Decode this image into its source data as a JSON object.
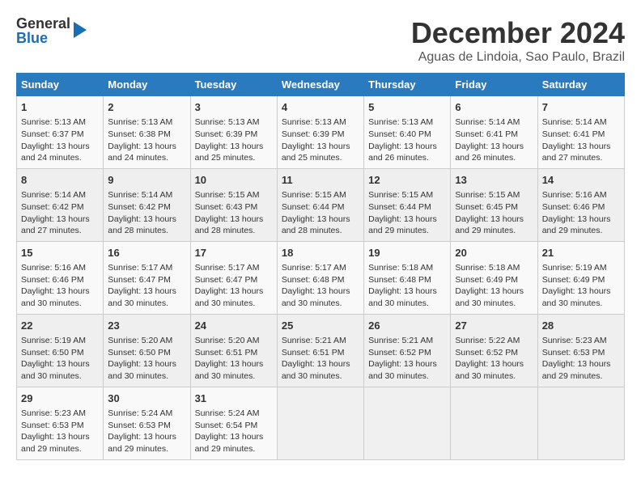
{
  "header": {
    "logo_general": "General",
    "logo_blue": "Blue",
    "month_title": "December 2024",
    "location": "Aguas de Lindoia, Sao Paulo, Brazil"
  },
  "weekdays": [
    "Sunday",
    "Monday",
    "Tuesday",
    "Wednesday",
    "Thursday",
    "Friday",
    "Saturday"
  ],
  "weeks": [
    [
      {
        "day": "1",
        "sunrise": "Sunrise: 5:13 AM",
        "sunset": "Sunset: 6:37 PM",
        "daylight": "Daylight: 13 hours and 24 minutes."
      },
      {
        "day": "2",
        "sunrise": "Sunrise: 5:13 AM",
        "sunset": "Sunset: 6:38 PM",
        "daylight": "Daylight: 13 hours and 24 minutes."
      },
      {
        "day": "3",
        "sunrise": "Sunrise: 5:13 AM",
        "sunset": "Sunset: 6:39 PM",
        "daylight": "Daylight: 13 hours and 25 minutes."
      },
      {
        "day": "4",
        "sunrise": "Sunrise: 5:13 AM",
        "sunset": "Sunset: 6:39 PM",
        "daylight": "Daylight: 13 hours and 25 minutes."
      },
      {
        "day": "5",
        "sunrise": "Sunrise: 5:13 AM",
        "sunset": "Sunset: 6:40 PM",
        "daylight": "Daylight: 13 hours and 26 minutes."
      },
      {
        "day": "6",
        "sunrise": "Sunrise: 5:14 AM",
        "sunset": "Sunset: 6:41 PM",
        "daylight": "Daylight: 13 hours and 26 minutes."
      },
      {
        "day": "7",
        "sunrise": "Sunrise: 5:14 AM",
        "sunset": "Sunset: 6:41 PM",
        "daylight": "Daylight: 13 hours and 27 minutes."
      }
    ],
    [
      {
        "day": "8",
        "sunrise": "Sunrise: 5:14 AM",
        "sunset": "Sunset: 6:42 PM",
        "daylight": "Daylight: 13 hours and 27 minutes."
      },
      {
        "day": "9",
        "sunrise": "Sunrise: 5:14 AM",
        "sunset": "Sunset: 6:42 PM",
        "daylight": "Daylight: 13 hours and 28 minutes."
      },
      {
        "day": "10",
        "sunrise": "Sunrise: 5:15 AM",
        "sunset": "Sunset: 6:43 PM",
        "daylight": "Daylight: 13 hours and 28 minutes."
      },
      {
        "day": "11",
        "sunrise": "Sunrise: 5:15 AM",
        "sunset": "Sunset: 6:44 PM",
        "daylight": "Daylight: 13 hours and 28 minutes."
      },
      {
        "day": "12",
        "sunrise": "Sunrise: 5:15 AM",
        "sunset": "Sunset: 6:44 PM",
        "daylight": "Daylight: 13 hours and 29 minutes."
      },
      {
        "day": "13",
        "sunrise": "Sunrise: 5:15 AM",
        "sunset": "Sunset: 6:45 PM",
        "daylight": "Daylight: 13 hours and 29 minutes."
      },
      {
        "day": "14",
        "sunrise": "Sunrise: 5:16 AM",
        "sunset": "Sunset: 6:46 PM",
        "daylight": "Daylight: 13 hours and 29 minutes."
      }
    ],
    [
      {
        "day": "15",
        "sunrise": "Sunrise: 5:16 AM",
        "sunset": "Sunset: 6:46 PM",
        "daylight": "Daylight: 13 hours and 30 minutes."
      },
      {
        "day": "16",
        "sunrise": "Sunrise: 5:17 AM",
        "sunset": "Sunset: 6:47 PM",
        "daylight": "Daylight: 13 hours and 30 minutes."
      },
      {
        "day": "17",
        "sunrise": "Sunrise: 5:17 AM",
        "sunset": "Sunset: 6:47 PM",
        "daylight": "Daylight: 13 hours and 30 minutes."
      },
      {
        "day": "18",
        "sunrise": "Sunrise: 5:17 AM",
        "sunset": "Sunset: 6:48 PM",
        "daylight": "Daylight: 13 hours and 30 minutes."
      },
      {
        "day": "19",
        "sunrise": "Sunrise: 5:18 AM",
        "sunset": "Sunset: 6:48 PM",
        "daylight": "Daylight: 13 hours and 30 minutes."
      },
      {
        "day": "20",
        "sunrise": "Sunrise: 5:18 AM",
        "sunset": "Sunset: 6:49 PM",
        "daylight": "Daylight: 13 hours and 30 minutes."
      },
      {
        "day": "21",
        "sunrise": "Sunrise: 5:19 AM",
        "sunset": "Sunset: 6:49 PM",
        "daylight": "Daylight: 13 hours and 30 minutes."
      }
    ],
    [
      {
        "day": "22",
        "sunrise": "Sunrise: 5:19 AM",
        "sunset": "Sunset: 6:50 PM",
        "daylight": "Daylight: 13 hours and 30 minutes."
      },
      {
        "day": "23",
        "sunrise": "Sunrise: 5:20 AM",
        "sunset": "Sunset: 6:50 PM",
        "daylight": "Daylight: 13 hours and 30 minutes."
      },
      {
        "day": "24",
        "sunrise": "Sunrise: 5:20 AM",
        "sunset": "Sunset: 6:51 PM",
        "daylight": "Daylight: 13 hours and 30 minutes."
      },
      {
        "day": "25",
        "sunrise": "Sunrise: 5:21 AM",
        "sunset": "Sunset: 6:51 PM",
        "daylight": "Daylight: 13 hours and 30 minutes."
      },
      {
        "day": "26",
        "sunrise": "Sunrise: 5:21 AM",
        "sunset": "Sunset: 6:52 PM",
        "daylight": "Daylight: 13 hours and 30 minutes."
      },
      {
        "day": "27",
        "sunrise": "Sunrise: 5:22 AM",
        "sunset": "Sunset: 6:52 PM",
        "daylight": "Daylight: 13 hours and 30 minutes."
      },
      {
        "day": "28",
        "sunrise": "Sunrise: 5:23 AM",
        "sunset": "Sunset: 6:53 PM",
        "daylight": "Daylight: 13 hours and 29 minutes."
      }
    ],
    [
      {
        "day": "29",
        "sunrise": "Sunrise: 5:23 AM",
        "sunset": "Sunset: 6:53 PM",
        "daylight": "Daylight: 13 hours and 29 minutes."
      },
      {
        "day": "30",
        "sunrise": "Sunrise: 5:24 AM",
        "sunset": "Sunset: 6:53 PM",
        "daylight": "Daylight: 13 hours and 29 minutes."
      },
      {
        "day": "31",
        "sunrise": "Sunrise: 5:24 AM",
        "sunset": "Sunset: 6:54 PM",
        "daylight": "Daylight: 13 hours and 29 minutes."
      },
      null,
      null,
      null,
      null
    ]
  ]
}
